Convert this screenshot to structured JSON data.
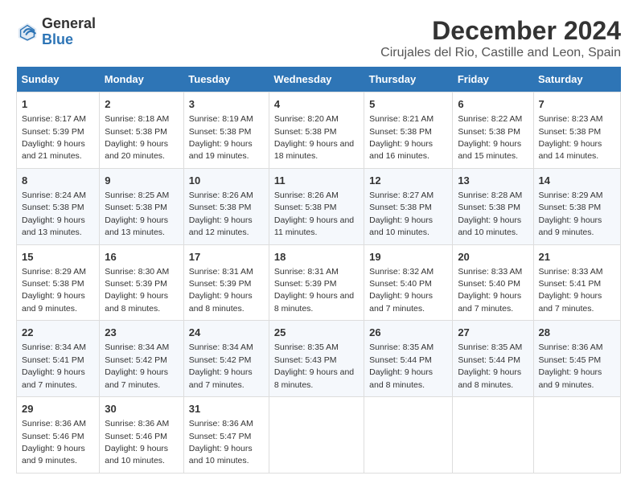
{
  "logo": {
    "line1": "General",
    "line2": "Blue"
  },
  "title": "December 2024",
  "subtitle": "Cirujales del Rio, Castille and Leon, Spain",
  "headers": [
    "Sunday",
    "Monday",
    "Tuesday",
    "Wednesday",
    "Thursday",
    "Friday",
    "Saturday"
  ],
  "weeks": [
    [
      {
        "day": "1",
        "sunrise": "8:17 AM",
        "sunset": "5:39 PM",
        "daylight": "9 hours and 21 minutes."
      },
      {
        "day": "2",
        "sunrise": "8:18 AM",
        "sunset": "5:38 PM",
        "daylight": "9 hours and 20 minutes."
      },
      {
        "day": "3",
        "sunrise": "8:19 AM",
        "sunset": "5:38 PM",
        "daylight": "9 hours and 19 minutes."
      },
      {
        "day": "4",
        "sunrise": "8:20 AM",
        "sunset": "5:38 PM",
        "daylight": "9 hours and 18 minutes."
      },
      {
        "day": "5",
        "sunrise": "8:21 AM",
        "sunset": "5:38 PM",
        "daylight": "9 hours and 16 minutes."
      },
      {
        "day": "6",
        "sunrise": "8:22 AM",
        "sunset": "5:38 PM",
        "daylight": "9 hours and 15 minutes."
      },
      {
        "day": "7",
        "sunrise": "8:23 AM",
        "sunset": "5:38 PM",
        "daylight": "9 hours and 14 minutes."
      }
    ],
    [
      {
        "day": "8",
        "sunrise": "8:24 AM",
        "sunset": "5:38 PM",
        "daylight": "9 hours and 13 minutes."
      },
      {
        "day": "9",
        "sunrise": "8:25 AM",
        "sunset": "5:38 PM",
        "daylight": "9 hours and 13 minutes."
      },
      {
        "day": "10",
        "sunrise": "8:26 AM",
        "sunset": "5:38 PM",
        "daylight": "9 hours and 12 minutes."
      },
      {
        "day": "11",
        "sunrise": "8:26 AM",
        "sunset": "5:38 PM",
        "daylight": "9 hours and 11 minutes."
      },
      {
        "day": "12",
        "sunrise": "8:27 AM",
        "sunset": "5:38 PM",
        "daylight": "9 hours and 10 minutes."
      },
      {
        "day": "13",
        "sunrise": "8:28 AM",
        "sunset": "5:38 PM",
        "daylight": "9 hours and 10 minutes."
      },
      {
        "day": "14",
        "sunrise": "8:29 AM",
        "sunset": "5:38 PM",
        "daylight": "9 hours and 9 minutes."
      }
    ],
    [
      {
        "day": "15",
        "sunrise": "8:29 AM",
        "sunset": "5:38 PM",
        "daylight": "9 hours and 9 minutes."
      },
      {
        "day": "16",
        "sunrise": "8:30 AM",
        "sunset": "5:39 PM",
        "daylight": "9 hours and 8 minutes."
      },
      {
        "day": "17",
        "sunrise": "8:31 AM",
        "sunset": "5:39 PM",
        "daylight": "9 hours and 8 minutes."
      },
      {
        "day": "18",
        "sunrise": "8:31 AM",
        "sunset": "5:39 PM",
        "daylight": "9 hours and 8 minutes."
      },
      {
        "day": "19",
        "sunrise": "8:32 AM",
        "sunset": "5:40 PM",
        "daylight": "9 hours and 7 minutes."
      },
      {
        "day": "20",
        "sunrise": "8:33 AM",
        "sunset": "5:40 PM",
        "daylight": "9 hours and 7 minutes."
      },
      {
        "day": "21",
        "sunrise": "8:33 AM",
        "sunset": "5:41 PM",
        "daylight": "9 hours and 7 minutes."
      }
    ],
    [
      {
        "day": "22",
        "sunrise": "8:34 AM",
        "sunset": "5:41 PM",
        "daylight": "9 hours and 7 minutes."
      },
      {
        "day": "23",
        "sunrise": "8:34 AM",
        "sunset": "5:42 PM",
        "daylight": "9 hours and 7 minutes."
      },
      {
        "day": "24",
        "sunrise": "8:34 AM",
        "sunset": "5:42 PM",
        "daylight": "9 hours and 7 minutes."
      },
      {
        "day": "25",
        "sunrise": "8:35 AM",
        "sunset": "5:43 PM",
        "daylight": "9 hours and 8 minutes."
      },
      {
        "day": "26",
        "sunrise": "8:35 AM",
        "sunset": "5:44 PM",
        "daylight": "9 hours and 8 minutes."
      },
      {
        "day": "27",
        "sunrise": "8:35 AM",
        "sunset": "5:44 PM",
        "daylight": "9 hours and 8 minutes."
      },
      {
        "day": "28",
        "sunrise": "8:36 AM",
        "sunset": "5:45 PM",
        "daylight": "9 hours and 9 minutes."
      }
    ],
    [
      {
        "day": "29",
        "sunrise": "8:36 AM",
        "sunset": "5:46 PM",
        "daylight": "9 hours and 9 minutes."
      },
      {
        "day": "30",
        "sunrise": "8:36 AM",
        "sunset": "5:46 PM",
        "daylight": "9 hours and 10 minutes."
      },
      {
        "day": "31",
        "sunrise": "8:36 AM",
        "sunset": "5:47 PM",
        "daylight": "9 hours and 10 minutes."
      },
      null,
      null,
      null,
      null
    ]
  ]
}
